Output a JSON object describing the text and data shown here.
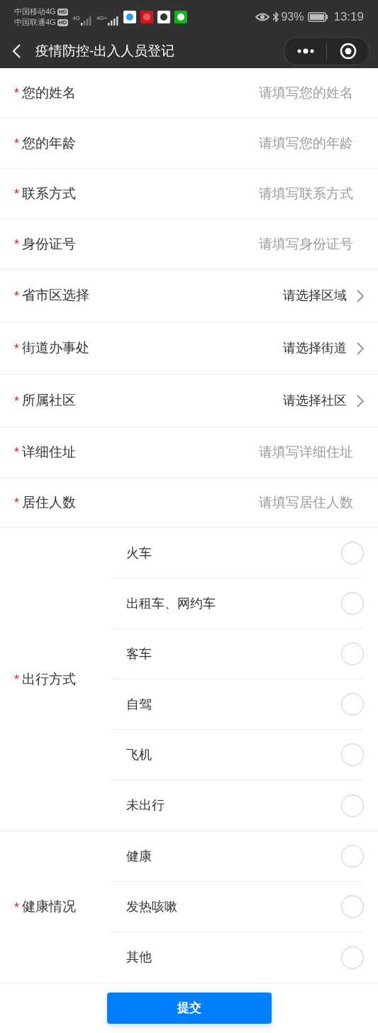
{
  "status_bar": {
    "carriers": [
      {
        "name": "中国移动4G",
        "badge": "HD"
      },
      {
        "name": "中国联通4G",
        "badge": "HD"
      }
    ],
    "signals": [
      {
        "label": "4G"
      },
      {
        "label": "4G+"
      }
    ],
    "battery": "93%",
    "time": "13:19"
  },
  "nav": {
    "title": "疫情防控-出入人员登记"
  },
  "fields": [
    {
      "kind": "input",
      "mark": "*",
      "label": "您的姓名",
      "placeholder": "请填写您的姓名"
    },
    {
      "kind": "input",
      "mark": "*",
      "label": "您的年龄",
      "placeholder": "请填写您的年龄"
    },
    {
      "kind": "input",
      "mark": "*",
      "label": "联系方式",
      "placeholder": "请填写联系方式"
    },
    {
      "kind": "input",
      "mark": "*",
      "label": "身份证号",
      "placeholder": "请填写身份证号"
    },
    {
      "kind": "select",
      "mark": "*",
      "label": "省市区选择",
      "value": "请选择区域"
    },
    {
      "kind": "select",
      "mark": "*",
      "label": "街道办事处",
      "value": "请选择街道"
    },
    {
      "kind": "select",
      "mark": "*",
      "label": "所属社区",
      "value": "请选择社区"
    },
    {
      "kind": "input",
      "mark": "*",
      "label": "详细住址",
      "placeholder": "请填写详细住址"
    },
    {
      "kind": "input",
      "mark": "*",
      "label": "居住人数",
      "placeholder": "请填写居住人数"
    }
  ],
  "groups": [
    {
      "mark": "*",
      "label": "出行方式",
      "options": [
        {
          "label": "火车",
          "selected": false
        },
        {
          "label": "出租车、网约车",
          "selected": false
        },
        {
          "label": "客车",
          "selected": false
        },
        {
          "label": "自驾",
          "selected": false
        },
        {
          "label": "飞机",
          "selected": false
        },
        {
          "label": "未出行",
          "selected": false
        }
      ]
    },
    {
      "mark": "*",
      "label": "健康情况",
      "options": [
        {
          "label": "健康",
          "selected": false
        },
        {
          "label": "发热咳嗽",
          "selected": false
        },
        {
          "label": "其他",
          "selected": false
        }
      ]
    }
  ],
  "submit": "提交"
}
